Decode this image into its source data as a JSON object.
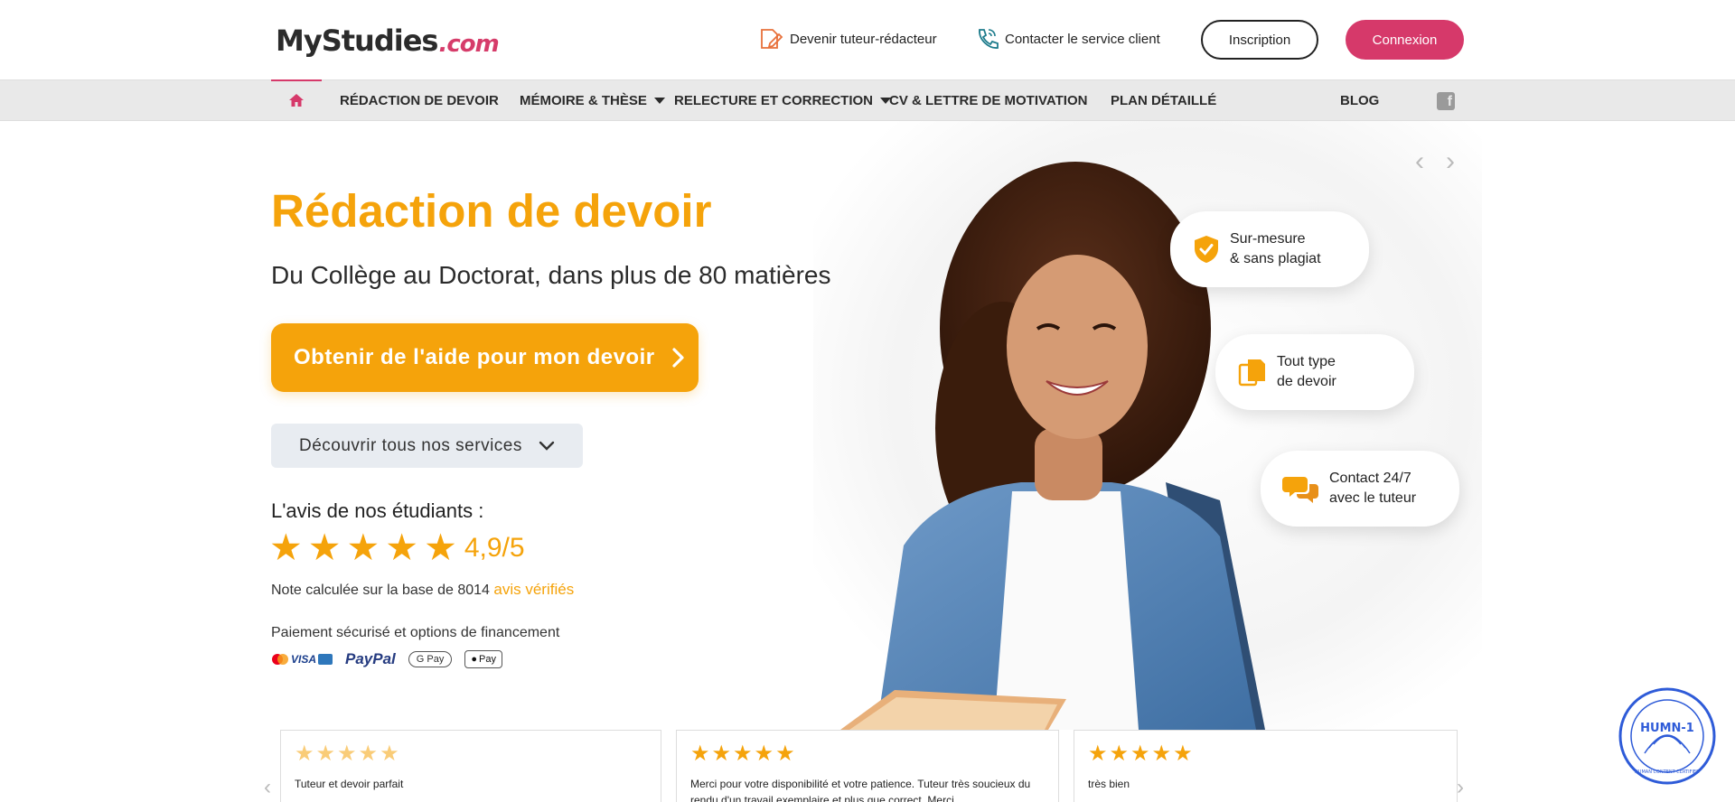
{
  "header": {
    "logo_main": "MyStudies",
    "logo_suffix": ".com",
    "link_tutor": "Devenir tuteur-rédacteur",
    "link_contact": "Contacter le service client",
    "btn_inscription": "Inscription",
    "btn_connexion": "Connexion"
  },
  "nav": {
    "items": [
      {
        "label": "RÉDACTION DE DEVOIR"
      },
      {
        "label": "MÉMOIRE & THÈSE"
      },
      {
        "label": "RELECTURE ET CORRECTION"
      },
      {
        "label": "CV & LETTRE DE MOTIVATION"
      },
      {
        "label": "PLAN DÉTAILLÉ"
      },
      {
        "label": "BLOG"
      }
    ]
  },
  "hero": {
    "title": "Rédaction de devoir",
    "subtitle": "Du Collège au Doctorat, dans plus de 80 matières",
    "cta_label": "Obtenir de l'aide pour mon devoir",
    "discover_label": "Découvrir tous nos services",
    "avis_title": "L'avis de nos étudiants :",
    "rating": "4,9/5",
    "note_prefix": "Note calculée sur la base de 8014",
    "note_link": "avis vérifiés",
    "payment_title": "Paiement sécurisé et options de financement",
    "payment_methods": {
      "cards": "VISA",
      "paypal": "PayPal",
      "gpay": "G Pay",
      "apple": "Pay"
    }
  },
  "features": [
    {
      "line1": "Sur-mesure",
      "line2": "& sans plagiat"
    },
    {
      "line1": "Tout type",
      "line2": "de devoir"
    },
    {
      "line1": "Contact 24/7",
      "line2": "avec le tuteur"
    }
  ],
  "reviews": [
    {
      "stars": "★★★★★",
      "text": "Tuteur et devoir parfait"
    },
    {
      "stars": "★★★★★",
      "text": "Merci pour votre disponibilité et votre patience. Tuteur très soucieux du rendu d'un travail exemplaire et plus que correct. Merci"
    },
    {
      "stars": "★★★★★",
      "text": "très bien"
    }
  ],
  "badge": {
    "label": "HUMN-1",
    "ring_text": "HUMAN CONTENT CERTIFIED"
  },
  "colors": {
    "accent_orange": "#f5a30b",
    "brand_pink": "#d6396a",
    "nav_bg": "#e9e9e9",
    "badge_blue": "#2e5bd8"
  }
}
